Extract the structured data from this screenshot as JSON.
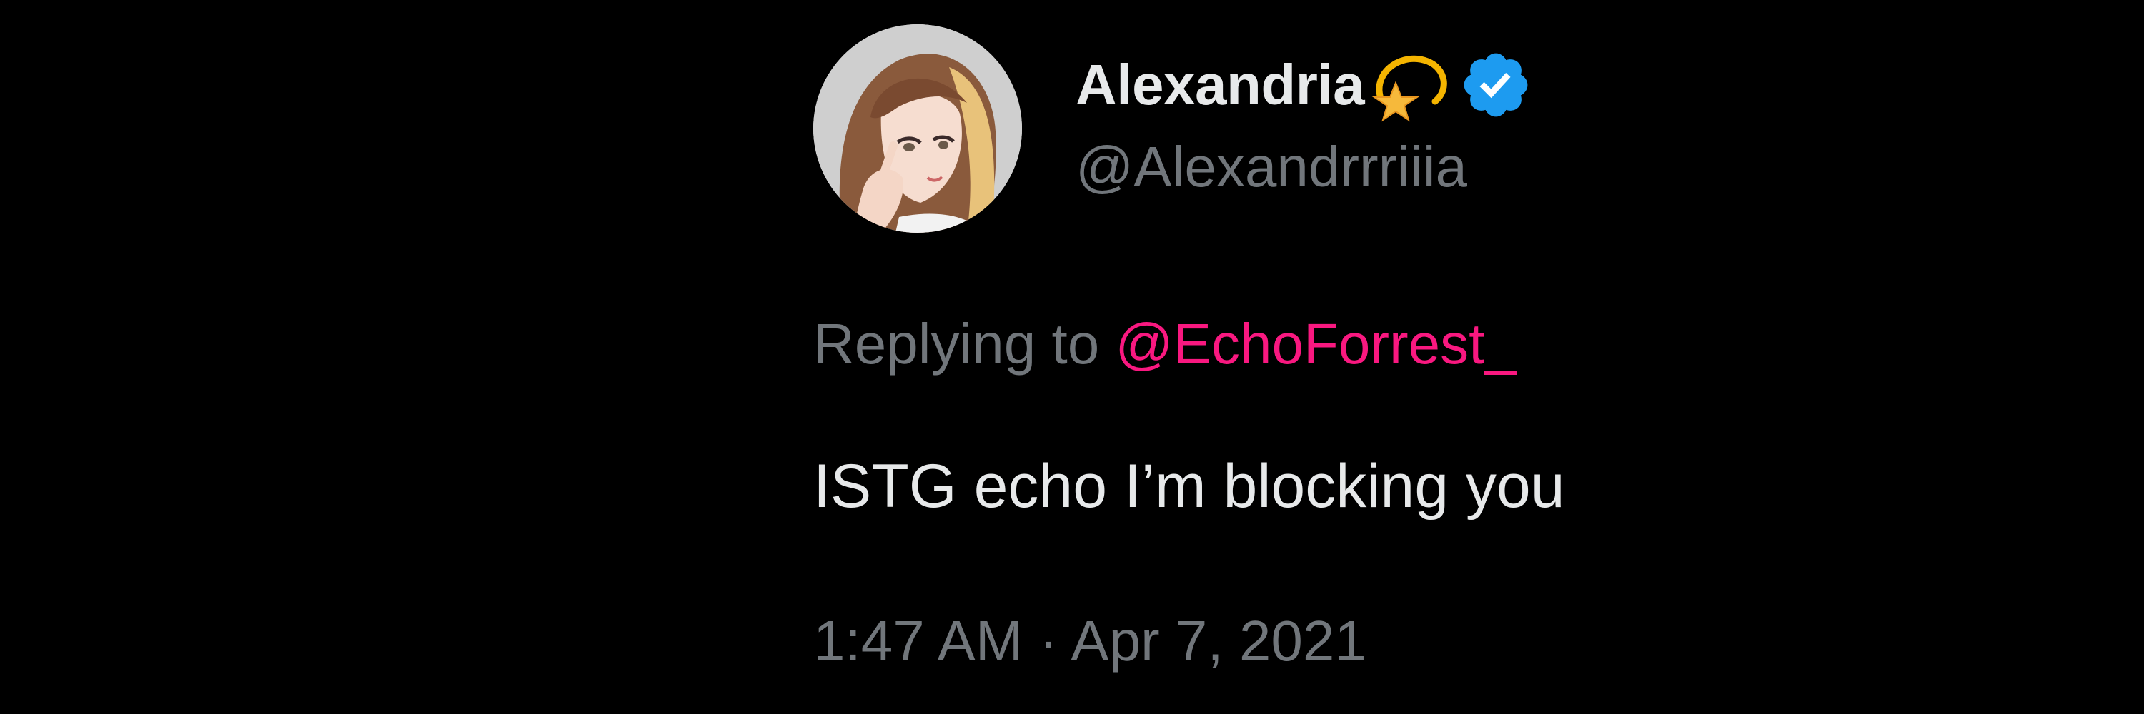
{
  "author": {
    "display_name": "Alexandria",
    "handle": "@Alexandrrriiia",
    "name_emoji_icon": "dizzy-star-emoji-icon",
    "verified_icon": "verified-badge-icon",
    "verified_color": "#1d9bf0",
    "avatar_icon": "anime-girl-avatar"
  },
  "reply": {
    "prefix": "Replying to ",
    "to_handle": "@EchoForrest_"
  },
  "tweet": {
    "text": "ISTG echo I’m blocking you",
    "time": "1:47 AM",
    "separator": " · ",
    "date": "Apr 7, 2021"
  },
  "colors": {
    "background": "#000000",
    "primary_text": "#e7e9ea",
    "secondary_text": "#71767b",
    "mention_link": "#f91880"
  }
}
